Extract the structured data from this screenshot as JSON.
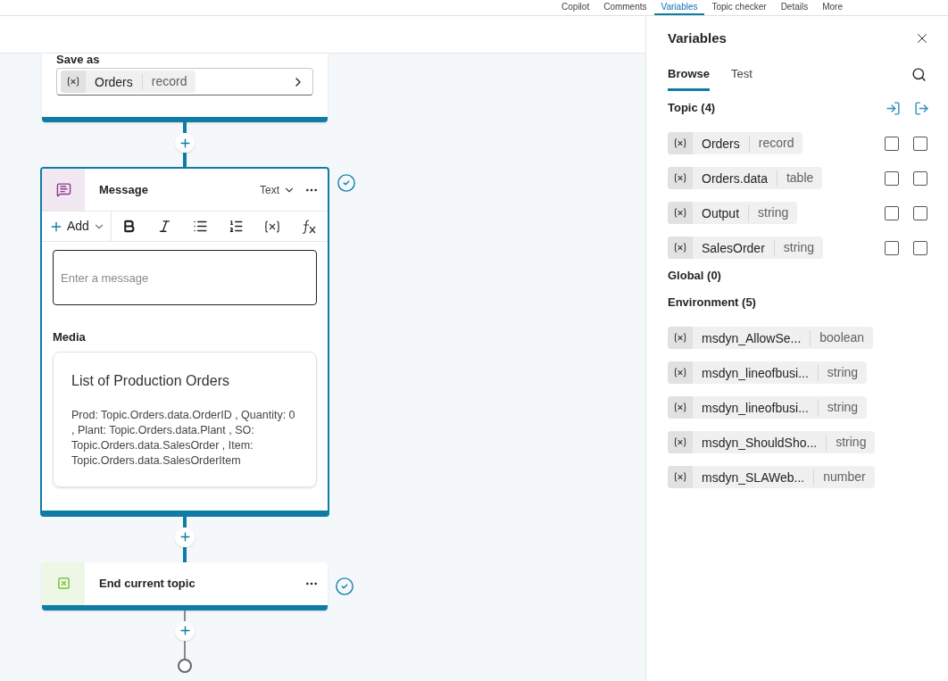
{
  "header_tabs": [
    {
      "label": "Copilot",
      "selected": false
    },
    {
      "label": "Comments",
      "selected": false
    },
    {
      "label": "Variables",
      "selected": true
    },
    {
      "label": "Topic checker",
      "selected": false
    },
    {
      "label": "Details",
      "selected": false
    },
    {
      "label": "More",
      "selected": false
    }
  ],
  "canvas": {
    "save_node": {
      "label": "Save as",
      "variable": "Orders",
      "type": "record"
    },
    "message_node": {
      "title": "Message",
      "format": "Text",
      "add_label": "Add",
      "placeholder": "Enter a message",
      "media_label": "Media",
      "card_title": "List of Production Orders",
      "card_text": "Prod: Topic.Orders.data.OrderID , Quantity: 0 , Plant: Topic.Orders.data.Plant , SO: Topic.Orders.data.SalesOrder , Item: Topic.Orders.data.SalesOrderItem"
    },
    "end_node": {
      "title": "End current topic"
    }
  },
  "variables_panel": {
    "title": "Variables",
    "tabs": [
      {
        "label": "Browse",
        "selected": true
      },
      {
        "label": "Test",
        "selected": false
      }
    ],
    "sections": [
      {
        "title": "Topic (4)",
        "variables": [
          {
            "name": "Orders",
            "type": "record",
            "input": false,
            "output": false
          },
          {
            "name": "Orders.data",
            "type": "table",
            "input": false,
            "output": false
          },
          {
            "name": "Output",
            "type": "string",
            "input": false,
            "output": false
          },
          {
            "name": "SalesOrder",
            "type": "string",
            "input": false,
            "output": false
          }
        ]
      },
      {
        "title": "Global (0)"
      },
      {
        "title": "Environment (5)",
        "variables": [
          {
            "name": "msdyn_AllowSe...",
            "type": "boolean"
          },
          {
            "name": "msdyn_lineofbusi...",
            "type": "string"
          },
          {
            "name": "msdyn_lineofbusi...",
            "type": "string"
          },
          {
            "name": "msdyn_ShouldSho...",
            "type": "string"
          },
          {
            "name": "msdyn_SLAWeb...",
            "type": "number"
          }
        ]
      }
    ]
  }
}
